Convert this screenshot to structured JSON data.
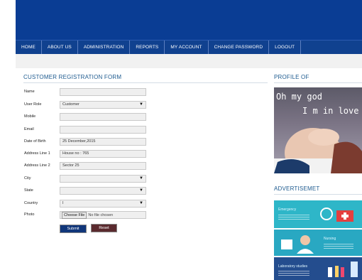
{
  "nav": {
    "items": [
      "HOME",
      "ABOUT US",
      "ADMINISTRATION",
      "REPORTS",
      "MY ACCOUNT",
      "CHANGE PASSWORD",
      "LOGOUT"
    ]
  },
  "form": {
    "title": "CUSTOMER REGISTRATION FORM",
    "fields": [
      {
        "label": "Name",
        "value": "",
        "type": "text"
      },
      {
        "label": "User Role",
        "value": "Customer",
        "type": "select"
      },
      {
        "label": "Mobile",
        "value": "",
        "type": "text"
      },
      {
        "label": "Email",
        "value": "",
        "type": "text"
      },
      {
        "label": "Date of Birth",
        "value": "25 December,2015",
        "type": "text"
      },
      {
        "label": "Address Line 1",
        "value": "House no : 765",
        "type": "text"
      },
      {
        "label": "Address Line 2",
        "value": "Sector 25",
        "type": "text"
      },
      {
        "label": "City",
        "value": "",
        "type": "select"
      },
      {
        "label": "State",
        "value": "",
        "type": "select"
      },
      {
        "label": "Country",
        "value": "I",
        "type": "select"
      },
      {
        "label": "Photo",
        "type": "file"
      }
    ],
    "file": {
      "button": "Choose File",
      "status": "No file chosen"
    },
    "submit_label": "Submit",
    "reset_label": "Reset"
  },
  "profile": {
    "title": "PROFILE OF",
    "image_text_line1": "Oh my god",
    "image_text_line2": "I m in love"
  },
  "ads": {
    "title": "ADVERTISEMET",
    "items": [
      "Emergency",
      "Nursing",
      "Laboratory studies"
    ]
  },
  "colors": {
    "header": "#0a3d94",
    "nav": "#10418f",
    "title": "#1d5a8f",
    "submit": "#10367a",
    "reset": "#5a2a2e"
  }
}
